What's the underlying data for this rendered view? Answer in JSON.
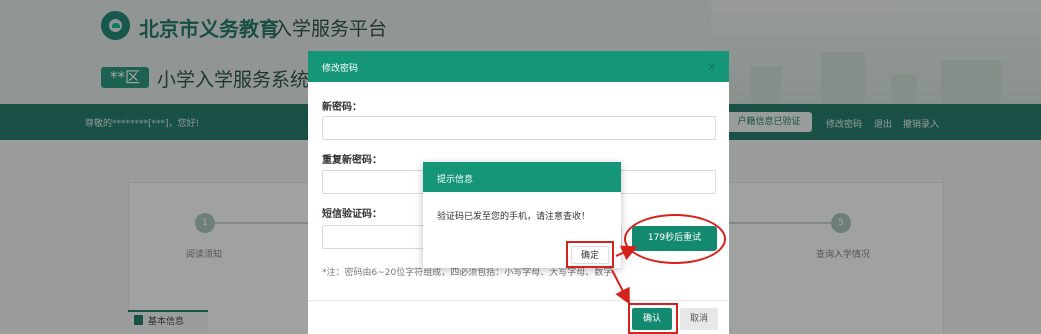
{
  "header": {
    "brand": "北京市义务教育",
    "platform": "入学服务平台",
    "district_tag": "**区",
    "system_name": "小学入学服务系统"
  },
  "navbar": {
    "greeting": "尊敬的********[***]，您好!",
    "hukou_badge": "户籍信息已验证",
    "links": [
      "修改密码",
      "退出",
      "撤销录入"
    ]
  },
  "steps": {
    "first": {
      "number": "1",
      "label": "阅读须知"
    },
    "last": {
      "number": "5",
      "label": "查询入学情况"
    }
  },
  "section": {
    "title": "基本信息"
  },
  "modal": {
    "title": "修改密码",
    "close": "×",
    "new_password_label": "新密码：",
    "confirm_password_label": "重复新密码：",
    "sms_code_label": "短信验证码：",
    "retry_button": "179秒后重试",
    "note": "*注：密码由6~20位字符组成，四必须包括：小写字母、大写字母、数字。",
    "confirm_button": "确认",
    "cancel_button": "取消"
  },
  "alert": {
    "title": "提示信息",
    "message": "验证码已发至您的手机，请注意查收！",
    "ok_button": "确定"
  },
  "colors": {
    "accent": "#138a70",
    "header_bar": "#116f5d",
    "annotation": "#d6221c"
  }
}
